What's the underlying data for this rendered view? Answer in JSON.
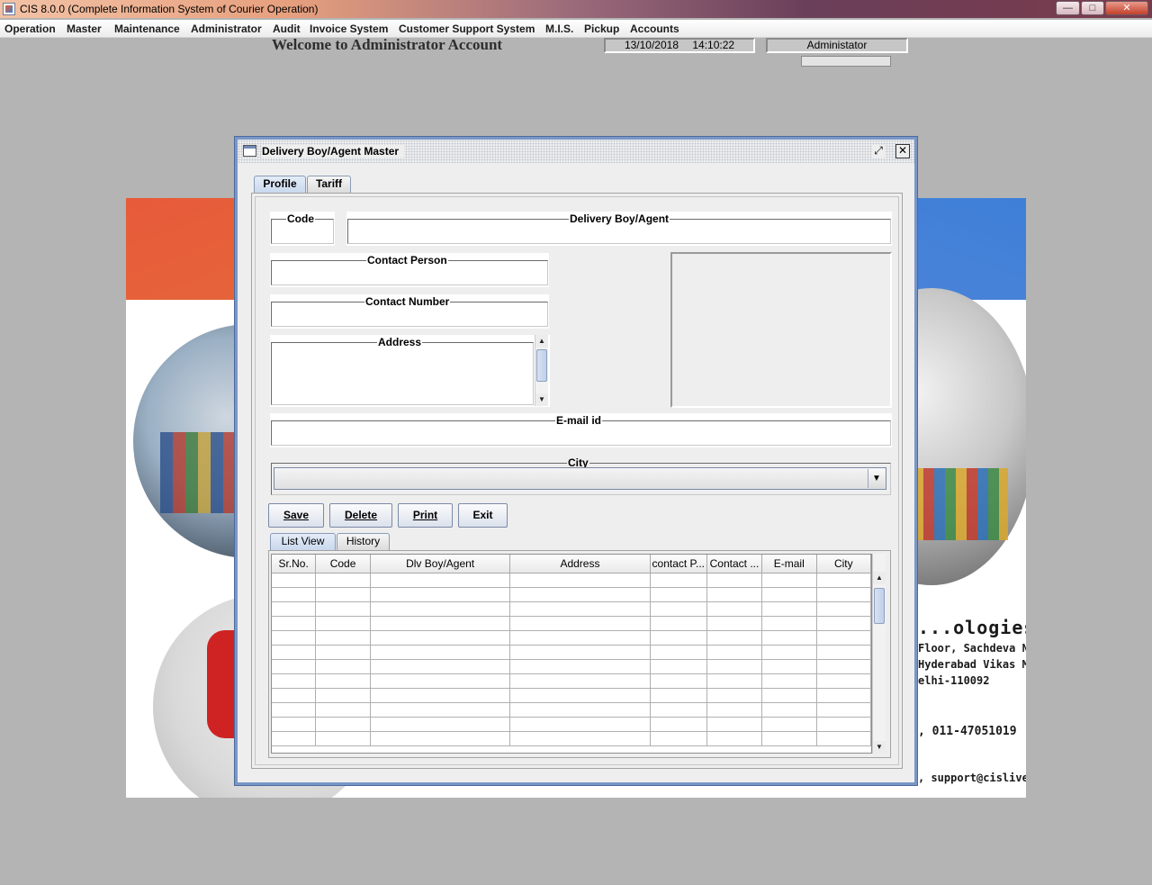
{
  "window": {
    "title": "CIS 8.0.0 (Complete Information System of Courier Operation)",
    "min_label": "—",
    "max_label": "□",
    "close_label": "✕"
  },
  "menu": [
    "Operation",
    "Master",
    "Maintenance",
    "Administrator",
    "Audit",
    "Invoice System",
    "Customer Support System",
    "M.I.S.",
    "Pickup",
    "Accounts"
  ],
  "header": {
    "welcome": "Welcome to Administrator Account",
    "date": "13/10/2018",
    "time": "14:10:22",
    "user": "Administator"
  },
  "background": {
    "company_name": "...ologies Pvt Ltd",
    "address_lines": [
      "Floor, Sachdeva Niwas",
      "Hyderabad Vikas Marg,",
      "elhi-110092"
    ],
    "phone": ", 011-47051019",
    "email": ", support@cislive.com",
    "accent_orange": "#e75a3a",
    "accent_blue": "#3f7fd8"
  },
  "dialog": {
    "title": "Delivery Boy/Agent Master",
    "restore_icon": "restore-icon",
    "close_icon": "close-icon",
    "tabs": [
      "Profile",
      "Tariff"
    ],
    "fields": {
      "code": "Code",
      "delivery_boy": "Delivery Boy/Agent",
      "contact_person": "Contact Person",
      "contact_number": "Contact Number",
      "address": "Address",
      "email": "E-mail id",
      "city": "City"
    },
    "buttons": {
      "save": "Save",
      "delete": "Delete",
      "print": "Print",
      "exit": "Exit"
    },
    "list_tabs": [
      "List View",
      "History"
    ],
    "table": {
      "columns": [
        "Sr.No.",
        "Code",
        "Dlv Boy/Agent",
        "Address",
        "contact P...",
        "Contact ...",
        "E-mail",
        "City"
      ],
      "rows": []
    }
  }
}
